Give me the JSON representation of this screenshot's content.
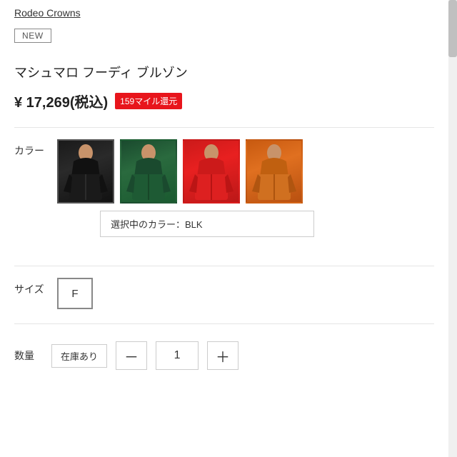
{
  "brand": {
    "name": "Rodeo Crowns",
    "link": "Rodeo Crowns"
  },
  "badge": {
    "new_label": "NEW"
  },
  "product": {
    "title": "マシュマロ フーディ ブルゾン",
    "price": "¥ 17,269(税込)",
    "mile_back": "159マイル還元"
  },
  "color": {
    "label": "カラー",
    "selected_label": "選択中のカラー：",
    "selected_value": "BLK",
    "options": [
      {
        "id": "blk",
        "name": "BLK",
        "css_class": "swatch-black",
        "selected": true
      },
      {
        "id": "grn",
        "name": "GRN",
        "css_class": "swatch-green",
        "selected": false
      },
      {
        "id": "red",
        "name": "RED",
        "css_class": "swatch-red",
        "selected": false
      },
      {
        "id": "orn",
        "name": "ORN",
        "css_class": "swatch-orange",
        "selected": false
      }
    ]
  },
  "size": {
    "label": "サイズ",
    "options": [
      {
        "id": "f",
        "name": "F",
        "selected": true
      }
    ]
  },
  "quantity": {
    "label": "数量",
    "stock_label": "在庫あり",
    "value": "1",
    "minus": "－",
    "plus": "＋"
  }
}
